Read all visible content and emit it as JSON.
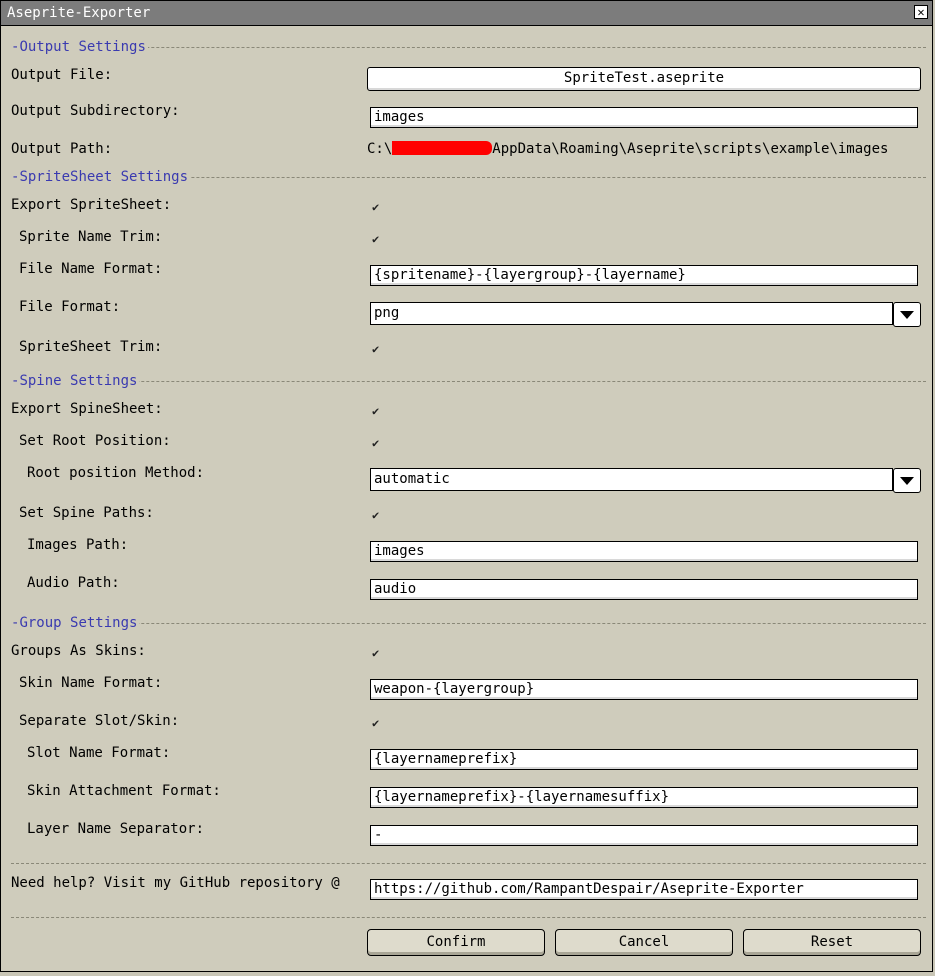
{
  "window": {
    "title": "Aseprite-Exporter",
    "close_icon": "close-icon"
  },
  "output": {
    "section": "Output Settings",
    "file_label": "Output File:",
    "file_value": "SpriteTest.aseprite",
    "subdir_label": "Output Subdirectory:",
    "subdir_value": "images",
    "path_label": "Output Path:",
    "path_prefix": "C:\\",
    "path_suffix": "AppData\\Roaming\\Aseprite\\scripts\\example\\images"
  },
  "spritesheet": {
    "section": "SpriteSheet Settings",
    "export_label": "Export SpriteSheet:",
    "export_checked": true,
    "trim_name_label": "Sprite Name Trim:",
    "trim_name_checked": true,
    "name_format_label": "File Name Format:",
    "name_format_value": "{spritename}-{layergroup}-{layername}",
    "file_format_label": "File Format:",
    "file_format_value": "png",
    "sheet_trim_label": "SpriteSheet Trim:",
    "sheet_trim_checked": true
  },
  "spine": {
    "section": "Spine Settings",
    "export_label": "Export SpineSheet:",
    "export_checked": true,
    "root_label": "Set Root Position:",
    "root_checked": true,
    "root_method_label": "Root position Method:",
    "root_method_value": "automatic",
    "paths_label": "Set Spine Paths:",
    "paths_checked": true,
    "images_label": "Images Path:",
    "images_value": "images",
    "audio_label": "Audio Path:",
    "audio_value": "audio"
  },
  "group": {
    "section": "Group Settings",
    "skins_label": "Groups As Skins:",
    "skins_checked": true,
    "skin_format_label": "Skin Name Format:",
    "skin_format_value": "weapon-{layergroup}",
    "separate_label": "Separate Slot/Skin:",
    "separate_checked": true,
    "slot_format_label": "Slot Name Format:",
    "slot_format_value": "{layernameprefix}",
    "attach_format_label": "Skin Attachment Format:",
    "attach_format_value": "{layernameprefix}-{layernamesuffix}",
    "separator_label": "Layer Name Separator:",
    "separator_value": "-"
  },
  "help": {
    "label": "Need help? Visit my GitHub repository @",
    "url": "https://github.com/RampantDespair/Aseprite-Exporter"
  },
  "buttons": {
    "confirm": "Confirm",
    "cancel": "Cancel",
    "reset": "Reset"
  }
}
